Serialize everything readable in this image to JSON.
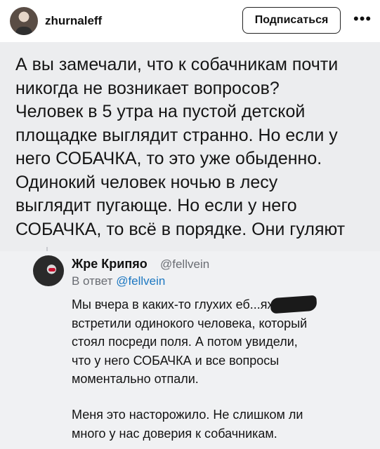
{
  "header": {
    "username": "zhurnaleff",
    "subscribe_label": "Подписаться",
    "more_label": "•••"
  },
  "post": {
    "text": "А вы замечали, что к собачникам почти\nникогда не возникает вопросов?\nЧеловек в 5 утра на пустой детской\nплощадке выглядит странно. Но если у\nнего СОБАЧКА, то это уже обыденно.\nОдинокий человек ночью в лесу\nвыглядит пугающе. Но если у него\nСОБАЧКА, то всё в порядке. Они гуляют"
  },
  "reply": {
    "author": "Жре Крипяо",
    "handle": "@fellvein",
    "reply_prefix": "В ответ",
    "reply_to": "@fellvein",
    "text_p1": "Мы вчера в каких-то глухих еб...ях\nвстретили одинокого человека, который\nстоял посреди поля. А потом увидели,\nчто у него СОБАЧКА и все вопросы\nмоментально отпали.",
    "text_p2": "Меня это насторожило. Не слишком ли\nмного у нас доверия к собачникам."
  }
}
